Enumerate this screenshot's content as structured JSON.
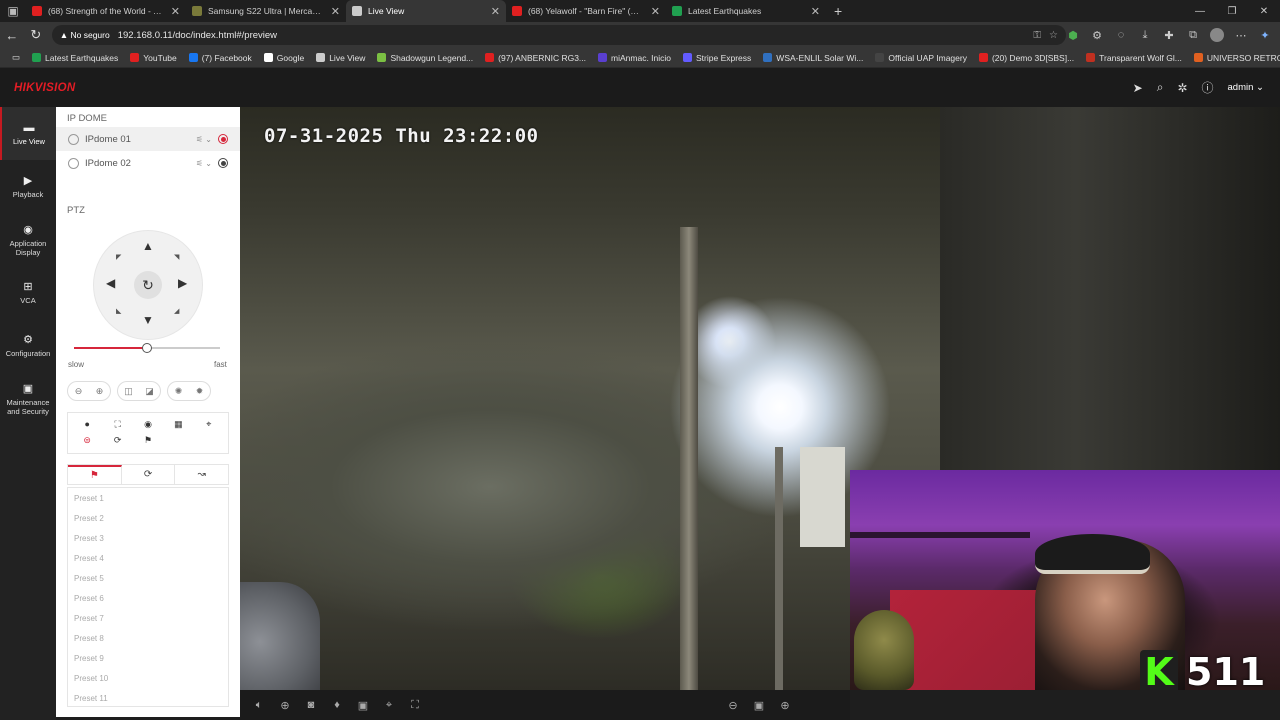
{
  "browser": {
    "tabs": [
      {
        "title": "(68) Strength of the World - YouT",
        "fav": "#e02020"
      },
      {
        "title": "Samsung S22 Ultra | MercadoLib",
        "fav": "#7a7a3a"
      },
      {
        "title": "Live View",
        "fav": "#cccccc",
        "active": true
      },
      {
        "title": "(68) Yelawolf - \"Barn Fire\" (Officia",
        "fav": "#e02020"
      },
      {
        "title": "Latest Earthquakes",
        "fav": "#20a050"
      }
    ],
    "not_secure": "No seguro",
    "url": "192.168.0.11/doc/index.html#/preview",
    "bookmarks": [
      {
        "label": "Latest Earthquakes",
        "color": "#20a050"
      },
      {
        "label": "YouTube",
        "color": "#e02020"
      },
      {
        "label": "(7) Facebook",
        "color": "#1877f2"
      },
      {
        "label": "Google",
        "color": "#ffffff"
      },
      {
        "label": "Live View",
        "color": "#cccccc"
      },
      {
        "label": "Shadowgun Legend...",
        "color": "#7bc043"
      },
      {
        "label": "(97) ANBERNIC RG3...",
        "color": "#e02020"
      },
      {
        "label": "miAnmac. Inicio",
        "color": "#5a3fd0"
      },
      {
        "label": "Stripe Express",
        "color": "#635bff"
      },
      {
        "label": "WSA-ENLIL Solar Wi...",
        "color": "#3070c0"
      },
      {
        "label": "Official UAP Imagery",
        "color": "#444444"
      },
      {
        "label": "(20) Demo 3D[SBS]...",
        "color": "#e02020"
      },
      {
        "label": "Transparent Wolf Gl...",
        "color": "#c03020"
      },
      {
        "label": "UNIVERSO RETRO...",
        "color": "#e06020"
      }
    ]
  },
  "header": {
    "logo": "HIKVISION",
    "user": "admin"
  },
  "nav": [
    {
      "label": "Live View",
      "icon": "monitor-icon",
      "glyph": "▬",
      "active": true
    },
    {
      "label": "Playback",
      "icon": "playback-icon",
      "glyph": "▶"
    },
    {
      "label": "Application Display",
      "icon": "application-icon",
      "glyph": "◉"
    },
    {
      "label": "VCA",
      "icon": "vca-icon",
      "glyph": "⊞"
    },
    {
      "label": "Configuration",
      "icon": "gear-icon",
      "glyph": "⚙"
    },
    {
      "label": "Maintenance and Security",
      "icon": "maintenance-icon",
      "glyph": "▣"
    }
  ],
  "panel": {
    "device_title": "IP DOME",
    "cameras": [
      {
        "name": "IPdome 01",
        "recording": true
      },
      {
        "name": "IPdome 02",
        "recording": false
      }
    ],
    "ptz_title": "PTZ",
    "speed_slow": "slow",
    "speed_fast": "fast",
    "speed_level": 0.5,
    "presets": [
      "Preset 1",
      "Preset 2",
      "Preset 3",
      "Preset 4",
      "Preset 5",
      "Preset 6",
      "Preset 7",
      "Preset 8",
      "Preset 9",
      "Preset 10",
      "Preset 11"
    ]
  },
  "video": {
    "osd": "07-31-2025 Thu 23:22:00"
  },
  "overlay": {
    "viewer_count": "511",
    "k_logo": "K"
  },
  "colors": {
    "accent": "#d6263b",
    "kick_green": "#53fc18"
  }
}
